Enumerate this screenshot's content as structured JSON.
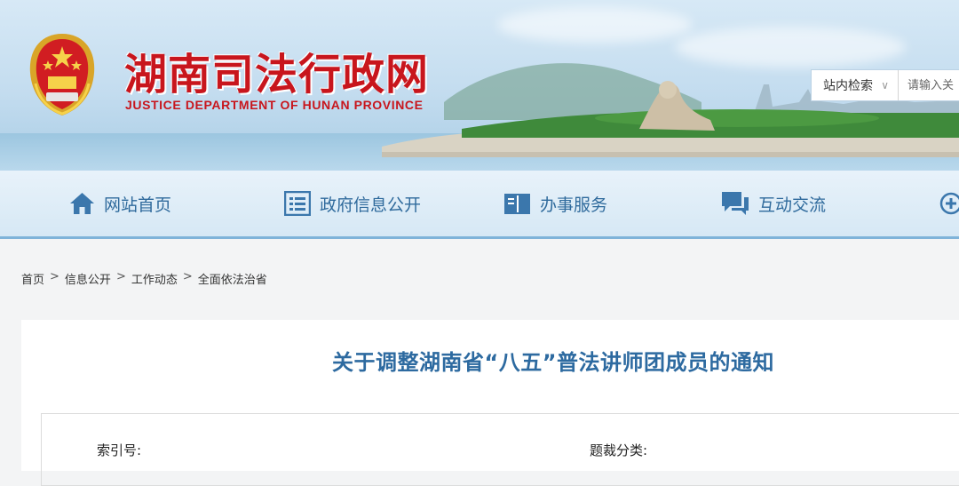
{
  "header": {
    "title": "湖南司法行政网",
    "subtitle": "JUSTICE DEPARTMENT OF HUNAN PROVINCE",
    "search": {
      "scope": "站内检索",
      "placeholder": "请输入关"
    }
  },
  "nav": {
    "items": [
      {
        "label": "网站首页",
        "icon": "home-icon"
      },
      {
        "label": "政府信息公开",
        "icon": "list-icon"
      },
      {
        "label": "办事服务",
        "icon": "book-icon"
      },
      {
        "label": "互动交流",
        "icon": "chat-icon"
      },
      {
        "label": "",
        "icon": "plus-circle-icon"
      }
    ]
  },
  "breadcrumb": [
    "首页",
    "信息公开",
    "工作动态",
    "全面依法治省"
  ],
  "breadcrumb_separator": ">",
  "article": {
    "title": "关于调整湖南省“八五”普法讲师团成员的通知",
    "index_label": "索引号:",
    "category_label": "题裁分类:"
  },
  "colors": {
    "brand_red": "#c8161d",
    "nav_blue": "#2f6a9c",
    "title_blue": "#2d6aa0"
  }
}
